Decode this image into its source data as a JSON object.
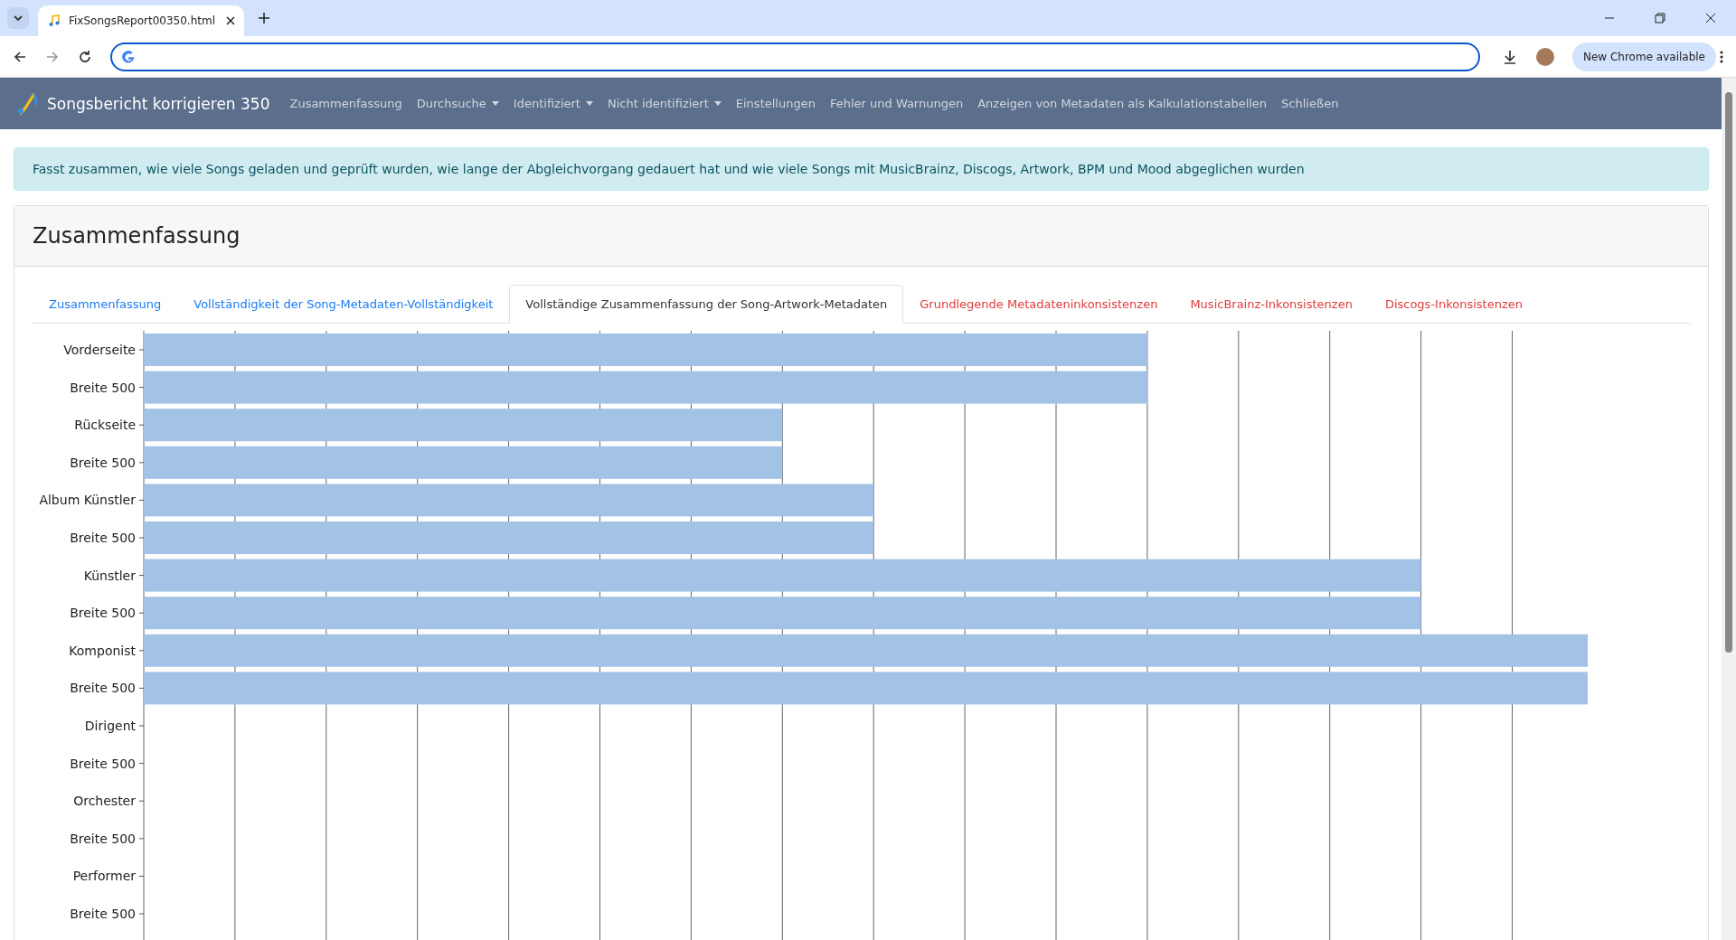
{
  "browser": {
    "tab_title": "FixSongsReport00350.html",
    "update_button": "New Chrome available"
  },
  "navbar": {
    "brand": "Songsbericht korrigieren 350",
    "items": [
      {
        "label": "Zusammenfassung",
        "dropdown": false
      },
      {
        "label": "Durchsuche",
        "dropdown": true
      },
      {
        "label": "Identifiziert",
        "dropdown": true
      },
      {
        "label": "Nicht identifiziert",
        "dropdown": true
      },
      {
        "label": "Einstellungen",
        "dropdown": false
      },
      {
        "label": "Fehler und Warnungen",
        "dropdown": false
      },
      {
        "label": "Anzeigen von Metadaten als Kalkulationstabellen",
        "dropdown": false
      },
      {
        "label": "Schließen",
        "dropdown": false
      }
    ]
  },
  "alert": "Fasst zusammen, wie viele Songs geladen und geprüft wurden, wie lange der Abgleichvorgang gedauert hat und wie viele Songs mit MusicBrainz, Discogs, Artwork, BPM und Mood abgeglichen wurden",
  "card": {
    "title": "Zusammenfassung",
    "tabs": [
      {
        "label": "Zusammenfassung",
        "kind": "info",
        "selected": false
      },
      {
        "label": "Vollständigkeit der Song-Metadaten-Vollständigkeit",
        "kind": "info",
        "selected": false
      },
      {
        "label": "Vollständige Zusammenfassung der Song-Artwork-Metadaten",
        "kind": "info",
        "selected": true
      },
      {
        "label": "Grundlegende Metadateninkonsistenzen",
        "kind": "error",
        "selected": false
      },
      {
        "label": "MusicBrainz-Inkonsistenzen",
        "kind": "error",
        "selected": false
      },
      {
        "label": "Discogs-Inkonsistenzen",
        "kind": "error",
        "selected": false
      }
    ],
    "chart_categories": [
      "Vorderseite",
      "Breite 500",
      "Rückseite",
      "Breite 500",
      "Album Künstler",
      "Breite 500",
      "Künstler",
      "Breite 500",
      "Komponist",
      "Breite 500",
      "Dirigent",
      "Breite 500",
      "Orchester",
      "Breite 500",
      "Performer",
      "Breite 500"
    ]
  }
}
